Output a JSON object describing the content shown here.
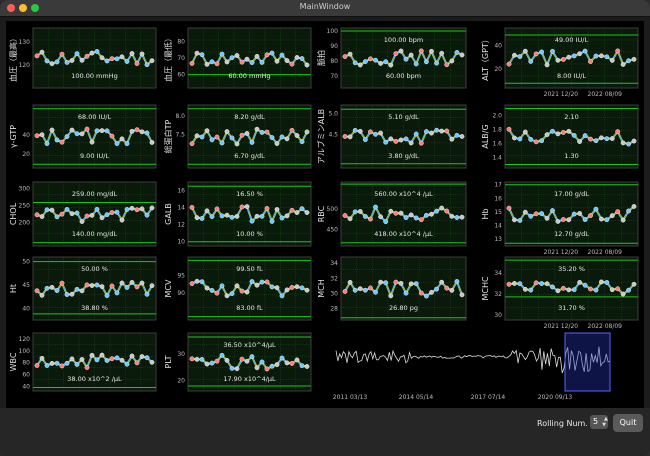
{
  "window": {
    "title": "MainWindow"
  },
  "controls": {
    "rolling_label": "Rolling Num.",
    "rolling_value": "5",
    "quit_label": "Quit"
  },
  "chart_data": [
    {
      "type": "line",
      "ylabel": "血圧（最高）",
      "yticks": [
        "120",
        "130"
      ],
      "upper_label": "",
      "lower_label": "100.00 mmHg",
      "ymin": 110,
      "ymax": 136,
      "upper": null,
      "lower": 100,
      "xticks": []
    },
    {
      "type": "line",
      "ylabel": "血圧（最低）",
      "yticks": [
        "60",
        "70",
        "80"
      ],
      "upper_label": "",
      "lower_label": "60.00 mmHg",
      "ymin": 52,
      "ymax": 88,
      "upper": null,
      "lower": 60,
      "xticks": []
    },
    {
      "type": "line",
      "ylabel": "脈拍",
      "yticks": [
        "70",
        "80",
        "90",
        "100"
      ],
      "upper_label": "100.00 bpm",
      "lower_label": "60.00 bpm",
      "ymin": 62,
      "ymax": 102,
      "upper": 100,
      "lower": 60,
      "xticks": []
    },
    {
      "type": "line",
      "ylabel": "ALT（GPT）",
      "yticks": [
        "20",
        "40"
      ],
      "upper_label": "49.00 IU/L",
      "lower_label": "8.00 IU/L",
      "ymin": 4,
      "ymax": 55,
      "upper": 49,
      "lower": 8,
      "xticks": [
        "2021 12/20",
        "2022 08/09"
      ]
    },
    {
      "type": "line",
      "ylabel": "γ-GTP",
      "yticks": [
        "20",
        "40"
      ],
      "upper_label": "68.00 IU/L",
      "lower_label": "9.00 IU/L",
      "ymin": 5,
      "ymax": 72,
      "upper": 68,
      "lower": 9,
      "xticks": []
    },
    {
      "type": "line",
      "ylabel": "総蛋白TP",
      "yticks": [
        "7.5",
        "8.0"
      ],
      "upper_label": "8.20 g/dL",
      "lower_label": "6.70 g/dL",
      "ymin": 6.6,
      "ymax": 8.3,
      "upper": 8.2,
      "lower": 6.7,
      "xticks": []
    },
    {
      "type": "line",
      "ylabel": "アルブミンALB",
      "yticks": [
        "4.5",
        "5.0"
      ],
      "upper_label": "5.10 g/dL",
      "lower_label": "3.80 g/dL",
      "ymin": 3.7,
      "ymax": 5.2,
      "upper": 5.1,
      "lower": 3.8,
      "xticks": []
    },
    {
      "type": "line",
      "ylabel": "ALB/G",
      "yticks": [
        "1.4",
        "1.6",
        "1.8",
        "2.0"
      ],
      "upper_label": "2.10",
      "lower_label": "1.30",
      "ymin": 1.25,
      "ymax": 2.15,
      "upper": 2.1,
      "lower": 1.3,
      "xticks": []
    },
    {
      "type": "line",
      "ylabel": "CHOL",
      "yticks": [
        "200",
        "250",
        "300"
      ],
      "upper_label": "259.00 mg/dL",
      "lower_label": "140.00 mg/dL",
      "ymin": 130,
      "ymax": 320,
      "upper": 259,
      "lower": 140,
      "xticks": []
    },
    {
      "type": "line",
      "ylabel": "GALB",
      "yticks": [
        "10",
        "12",
        "14",
        "16"
      ],
      "upper_label": "16.50 %",
      "lower_label": "10.00 %",
      "ymin": 9.5,
      "ymax": 17,
      "upper": 16.5,
      "lower": 10,
      "xticks": []
    },
    {
      "type": "line",
      "ylabel": "RBC",
      "yticks": [
        "450",
        "500"
      ],
      "upper_label": "560.00 x10^4 /μL",
      "lower_label": "418.00 x10^4 /μL",
      "ymin": 410,
      "ymax": 565,
      "upper": 560,
      "lower": 418,
      "xticks": []
    },
    {
      "type": "line",
      "ylabel": "Hb",
      "yticks": [
        "13",
        "14",
        "15",
        "16",
        "17"
      ],
      "upper_label": "17.00 g/dL",
      "lower_label": "12.70 g/dL",
      "ymin": 12.5,
      "ymax": 17.2,
      "upper": 17,
      "lower": 12.7,
      "xticks": [
        "2021 12/20",
        "2022 08/09"
      ]
    },
    {
      "type": "line",
      "ylabel": "Ht",
      "yticks": [
        "40",
        "45",
        "50"
      ],
      "upper_label": "50.00 %",
      "lower_label": "38.80 %",
      "ymin": 37.5,
      "ymax": 51,
      "upper": 50,
      "lower": 38.8,
      "xticks": []
    },
    {
      "type": "line",
      "ylabel": "MCV",
      "yticks": [
        "90",
        "95"
      ],
      "upper_label": "99.50 fL",
      "lower_label": "83.00 fL",
      "ymin": 82,
      "ymax": 100.5,
      "upper": 99.5,
      "lower": 83,
      "xticks": []
    },
    {
      "type": "line",
      "ylabel": "MCH",
      "yticks": [
        "28",
        "30",
        "32",
        "34"
      ],
      "upper_label": "",
      "lower_label": "26.80 pg",
      "ymin": 26.5,
      "ymax": 34.8,
      "upper": null,
      "lower": 26.8,
      "xticks": []
    },
    {
      "type": "line",
      "ylabel": "MCHC",
      "yticks": [
        "30",
        "32",
        "34"
      ],
      "upper_label": "35.20 %",
      "lower_label": "31.70 %",
      "ymin": 29.5,
      "ymax": 35.5,
      "upper": 35.2,
      "lower": 31.7,
      "xticks": [
        "2021 12/20",
        "2022 08/09"
      ]
    },
    {
      "type": "line",
      "ylabel": "WBC",
      "yticks": [
        "40",
        "60",
        "80",
        "100",
        "120"
      ],
      "upper_label": "",
      "lower_label": "38.00 x10^2 /μL",
      "ymin": 32,
      "ymax": 130,
      "upper": null,
      "lower": 38,
      "xticks": []
    },
    {
      "type": "line",
      "ylabel": "PLT",
      "yticks": [
        "20",
        "30"
      ],
      "upper_label": "36.50 x10^4/μL",
      "lower_label": "17.90 x10^4/μL",
      "ymin": 16,
      "ymax": 38,
      "upper": 36.5,
      "lower": 17.9,
      "xticks": []
    },
    {
      "type": "line",
      "ylabel": "",
      "yticks": [],
      "upper_label": "",
      "lower_label": "",
      "overview": true,
      "xticks": [
        "2011 03/13",
        "2014 05/14",
        "2017 07/14",
        "2020 09/13"
      ]
    }
  ]
}
